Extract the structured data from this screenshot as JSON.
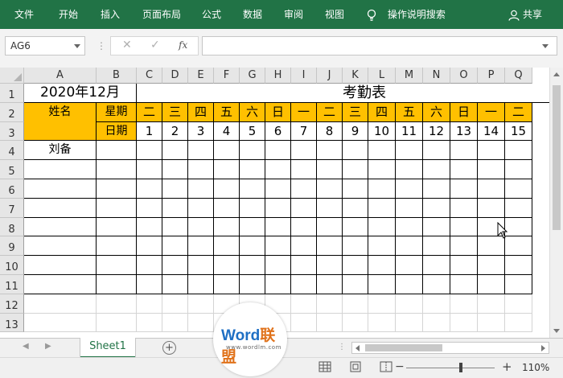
{
  "ribbon": {
    "tabs": [
      "文件",
      "开始",
      "插入",
      "页面布局",
      "公式",
      "数据",
      "审阅",
      "视图"
    ],
    "tell_me": "操作说明搜索",
    "share": "共享"
  },
  "formula_bar": {
    "name_box": "AG6",
    "cancel_icon": "close-icon",
    "enter_icon": "check-icon",
    "fx_label": "fx",
    "formula_value": ""
  },
  "columns": [
    "A",
    "B",
    "C",
    "D",
    "E",
    "F",
    "G",
    "H",
    "I",
    "J",
    "K",
    "L",
    "M",
    "N",
    "O",
    "P",
    "Q"
  ],
  "rows": [
    "1",
    "2",
    "3",
    "4",
    "5",
    "6",
    "7",
    "8",
    "9",
    "10",
    "11",
    "12",
    "13"
  ],
  "sheet": {
    "title_month": "2020年12月",
    "title": "考勤表",
    "header_name": "姓名",
    "header_weekday": "星期",
    "header_date": "日期",
    "weekdays": [
      "二",
      "三",
      "四",
      "五",
      "六",
      "日",
      "一",
      "二",
      "三",
      "四",
      "五",
      "六",
      "日",
      "一",
      "二"
    ],
    "dates": [
      "1",
      "2",
      "3",
      "4",
      "5",
      "6",
      "7",
      "8",
      "9",
      "10",
      "11",
      "12",
      "13",
      "14",
      "15"
    ],
    "employees": [
      "刘备"
    ],
    "header_fill_color": "#ffc000"
  },
  "tabs_bar": {
    "sheet_name": "Sheet1",
    "add_sheet": "⊕"
  },
  "status": {
    "zoom_minus": "−",
    "zoom_plus": "+",
    "zoom_level": "110%",
    "zoom_fraction": 0.6
  },
  "watermark": {
    "brand_latin": "Word",
    "brand_cn": "联盟",
    "url": "www.wordlm.com"
  }
}
